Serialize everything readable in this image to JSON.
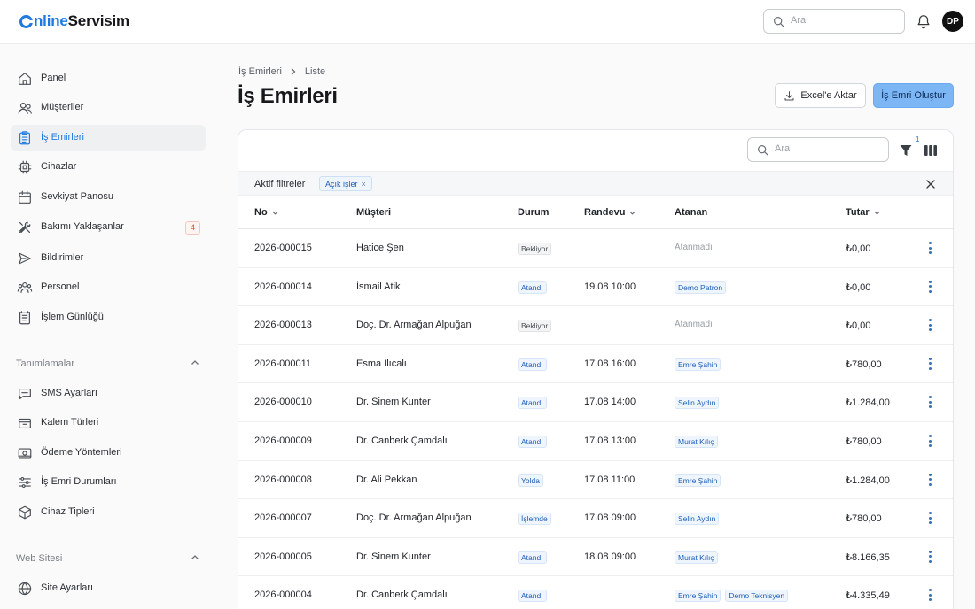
{
  "app": {
    "logo_part1": "nline",
    "logo_part2": "Servisim",
    "search_placeholder": "Ara",
    "user_initials": "DP"
  },
  "sidebar": {
    "items": [
      {
        "label": "Panel",
        "icon": "home-icon"
      },
      {
        "label": "Müşteriler",
        "icon": "users-icon"
      },
      {
        "label": "İş Emirleri",
        "icon": "clipboard-icon",
        "active": true
      },
      {
        "label": "Cihazlar",
        "icon": "chip-icon"
      },
      {
        "label": "Sevkiyat Panosu",
        "icon": "calendar-icon"
      },
      {
        "label": "Bakımı Yaklaşanlar",
        "icon": "tools-icon",
        "badge": "4"
      },
      {
        "label": "Bildirimler",
        "icon": "send-icon"
      },
      {
        "label": "Personel",
        "icon": "team-icon"
      },
      {
        "label": "İşlem Günlüğü",
        "icon": "log-icon"
      }
    ],
    "section_definitions": "Tanımlamalar",
    "definitions": [
      {
        "label": "SMS Ayarları",
        "icon": "sms-icon"
      },
      {
        "label": "Kalem Türleri",
        "icon": "box-icon"
      },
      {
        "label": "Ödeme Yöntemleri",
        "icon": "payment-icon"
      },
      {
        "label": "İş Emri Durumları",
        "icon": "sliders-icon"
      },
      {
        "label": "Cihaz Tipleri",
        "icon": "cube-icon"
      }
    ],
    "section_website": "Web Sitesi",
    "website": [
      {
        "label": "Site Ayarları",
        "icon": "globe-icon"
      }
    ]
  },
  "breadcrumb": {
    "root": "İş Emirleri",
    "current": "Liste"
  },
  "page": {
    "title": "İş Emirleri",
    "export_label": "Excel'e Aktar",
    "create_label": "İş Emri Oluştur"
  },
  "table": {
    "search_placeholder": "Ara",
    "filter_count": "1",
    "active_filters_label": "Aktif filtreler",
    "active_filter_chip": "Açık işler",
    "columns": {
      "no": "No",
      "customer": "Müşteri",
      "status": "Durum",
      "appointment": "Randevu",
      "assignee": "Atanan",
      "amount": "Tutar"
    },
    "unassigned_label": "Atanmadı",
    "rows": [
      {
        "no": "2026-000015",
        "customer": "Hatice Şen",
        "status": "Bekliyor",
        "status_tone": "gray",
        "appointment": "",
        "assignees": [],
        "amount": "₺0,00"
      },
      {
        "no": "2026-000014",
        "customer": "İsmail Atik",
        "status": "Atandı",
        "status_tone": "blue",
        "appointment": "19.08 10:00",
        "assignees": [
          "Demo Patron"
        ],
        "amount": "₺0,00"
      },
      {
        "no": "2026-000013",
        "customer": "Doç. Dr. Armağan Alpuğan",
        "status": "Bekliyor",
        "status_tone": "gray",
        "appointment": "",
        "assignees": [],
        "amount": "₺0,00"
      },
      {
        "no": "2026-000011",
        "customer": "Esma Ilıcalı",
        "status": "Atandı",
        "status_tone": "blue",
        "appointment": "17.08 16:00",
        "assignees": [
          "Emre Şahin"
        ],
        "amount": "₺780,00"
      },
      {
        "no": "2026-000010",
        "customer": "Dr. Sinem Kunter",
        "status": "Atandı",
        "status_tone": "blue",
        "appointment": "17.08 14:00",
        "assignees": [
          "Selin Aydın"
        ],
        "amount": "₺1.284,00"
      },
      {
        "no": "2026-000009",
        "customer": "Dr. Canberk Çamdalı",
        "status": "Atandı",
        "status_tone": "blue",
        "appointment": "17.08 13:00",
        "assignees": [
          "Murat Kılıç"
        ],
        "amount": "₺780,00"
      },
      {
        "no": "2026-000008",
        "customer": "Dr. Ali Pekkan",
        "status": "Yolda",
        "status_tone": "blue",
        "appointment": "17.08 11:00",
        "assignees": [
          "Emre Şahin"
        ],
        "amount": "₺1.284,00"
      },
      {
        "no": "2026-000007",
        "customer": "Doç. Dr. Armağan Alpuğan",
        "status": "İşlemde",
        "status_tone": "blue",
        "appointment": "17.08 09:00",
        "assignees": [
          "Selin Aydın"
        ],
        "amount": "₺780,00"
      },
      {
        "no": "2026-000005",
        "customer": "Dr. Sinem Kunter",
        "status": "Atandı",
        "status_tone": "blue",
        "appointment": "18.08 09:00",
        "assignees": [
          "Murat Kılıç"
        ],
        "amount": "₺8.166,35"
      },
      {
        "no": "2026-000004",
        "customer": "Dr. Canberk Çamdalı",
        "status": "Atandı",
        "status_tone": "blue",
        "appointment": "",
        "assignees": [
          "Emre Şahin",
          "Demo Teknisyen"
        ],
        "amount": "₺4.335,49"
      }
    ]
  },
  "colors": {
    "accent": "#1f7ae0",
    "primary_button": "#7db6f5",
    "badge": "#d9532e"
  }
}
